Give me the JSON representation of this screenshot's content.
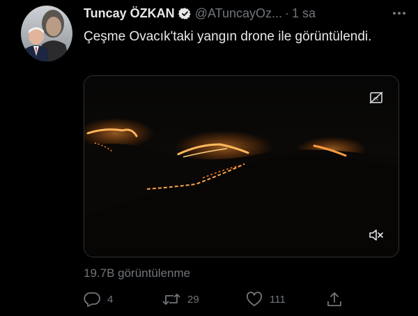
{
  "tweet": {
    "display_name": "Tuncay ÖZKAN",
    "handle": "@ATuncayOz...",
    "separator": "·",
    "time": "1 sa",
    "text": "Çeşme Ovacık'taki yangın drone ile görüntülendi.",
    "views": "19.7B görüntülenme",
    "verified_icon": "verified-badge-icon",
    "more_icon": "more-options-icon"
  },
  "media": {
    "type": "video",
    "cc_icon": "closed-captions-icon",
    "mute_icon": "volume-muted-icon"
  },
  "actions": {
    "reply_count": "4",
    "retweet_count": "29",
    "like_count": "111",
    "reply_icon": "reply-icon",
    "retweet_icon": "retweet-icon",
    "like_icon": "like-heart-icon",
    "share_icon": "share-icon"
  },
  "colors": {
    "background": "#000000",
    "text_primary": "#e7e9ea",
    "text_secondary": "#71767b",
    "fire_orange": "#ff8a2a"
  }
}
